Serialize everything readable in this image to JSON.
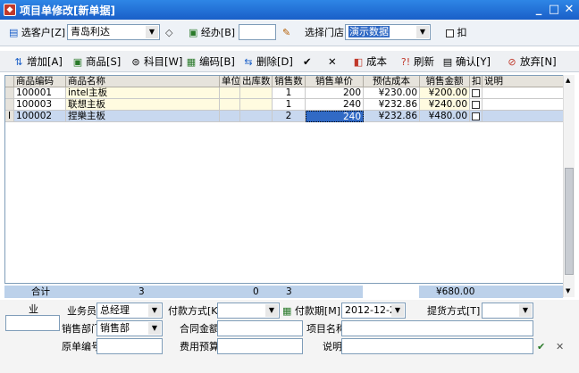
{
  "window": {
    "title": "项目单修改[新单据]",
    "minimize_glyph": "_",
    "maximize_glyph": "□",
    "close_glyph": "✕"
  },
  "query": {
    "customer_label": "选客户[Z]",
    "customer_value": "青岛利达",
    "handler_label": "经办[B]",
    "handler_value": "",
    "store_label": "选择门店",
    "store_value": "演示数据",
    "deduct_label": "扣"
  },
  "toolbar": {
    "add": "增加[A]",
    "product": "商品[S]",
    "subject": "科目[W]",
    "code": "编码[B]",
    "delete": "删除[D]",
    "check": "✔",
    "cross": "✕",
    "cost": "成本",
    "refresh": "刷新",
    "confirm": "确认[Y]",
    "abandon": "放弃[N]"
  },
  "grid": {
    "columns": [
      "商品编码",
      "商品名称",
      "单位",
      "出库数",
      "销售数",
      "销售单价",
      "预估成本",
      "销售金额",
      "扣",
      "说明"
    ],
    "rows": [
      {
        "code": "100001",
        "name": "intel主板",
        "unit": "",
        "out": "",
        "qty": "1",
        "price": "200",
        "est_cost": "¥230.00",
        "amount": "¥200.00",
        "note": ""
      },
      {
        "code": "100003",
        "name": "联想主板",
        "unit": "",
        "out": "",
        "qty": "1",
        "price": "240",
        "est_cost": "¥232.86",
        "amount": "¥240.00",
        "note": ""
      },
      {
        "code": "100002",
        "name": "捏樂主板",
        "unit": "",
        "out": "",
        "qty": "2",
        "price": "240",
        "est_cost": "¥232.86",
        "amount": "¥480.00",
        "note": ""
      }
    ],
    "current_marker": "I",
    "totals": {
      "label": "合计",
      "name_count": "3",
      "out": "0",
      "qty": "3",
      "amount": "¥680.00"
    }
  },
  "form": {
    "ye_label": "业",
    "salesman_label": "业务员",
    "salesman_value": "总经理",
    "pay_method_label": "付款方式[K]",
    "pay_method_value": "",
    "pay_date_label": "付款期[M]",
    "pay_date_value": "2012-12-26",
    "delivery_label": "提货方式[T]",
    "delivery_value": "",
    "dept_label": "销售部门",
    "dept_value": "销售部",
    "contract_label": "合同金额",
    "contract_value": "",
    "project_label": "项目名称",
    "project_value": "",
    "orig_no_label": "原单编号",
    "orig_no_value": "",
    "budget_label": "费用预算",
    "budget_value": "",
    "remark_label": "说明",
    "remark_value": ""
  },
  "colors": {
    "title_bg": "#1a5fc8",
    "row_alt": "#fffbe0",
    "selected_row": "#c8d8ef",
    "selected_cell": "#316ac5",
    "sum_row": "#bcd1ea"
  }
}
